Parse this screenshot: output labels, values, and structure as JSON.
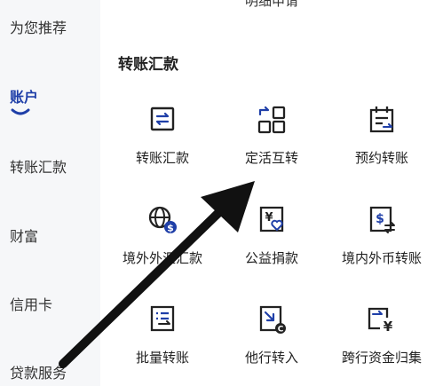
{
  "sidebar": {
    "items": [
      {
        "label": "为您推荐"
      },
      {
        "label": "账户"
      },
      {
        "label": "转账汇款"
      },
      {
        "label": "财富"
      },
      {
        "label": "信用卡"
      },
      {
        "label": "贷款服务"
      }
    ]
  },
  "main": {
    "top_partial_label": "明细申请",
    "section_title": "转账汇款",
    "items": [
      {
        "label": "转账汇款",
        "icon": "transfer-icon"
      },
      {
        "label": "定活互转",
        "icon": "swap-grid-icon"
      },
      {
        "label": "预约转账",
        "icon": "calendar-transfer-icon"
      },
      {
        "label": "境外外汇汇款",
        "icon": "globe-dollar-icon"
      },
      {
        "label": "公益捐款",
        "icon": "yen-heart-icon"
      },
      {
        "label": "境内外币转账",
        "icon": "dollar-doc-icon"
      },
      {
        "label": "批量转账",
        "icon": "list-transfer-icon"
      },
      {
        "label": "他行转入",
        "icon": "arrow-in-icon"
      },
      {
        "label": "跨行资金归集",
        "icon": "yen-collect-icon"
      }
    ]
  },
  "colors": {
    "accent": "#1f3fa8",
    "icon_stroke": "#222222",
    "sidebar_bg": "#f6f7f9",
    "arrow": "#111111"
  }
}
